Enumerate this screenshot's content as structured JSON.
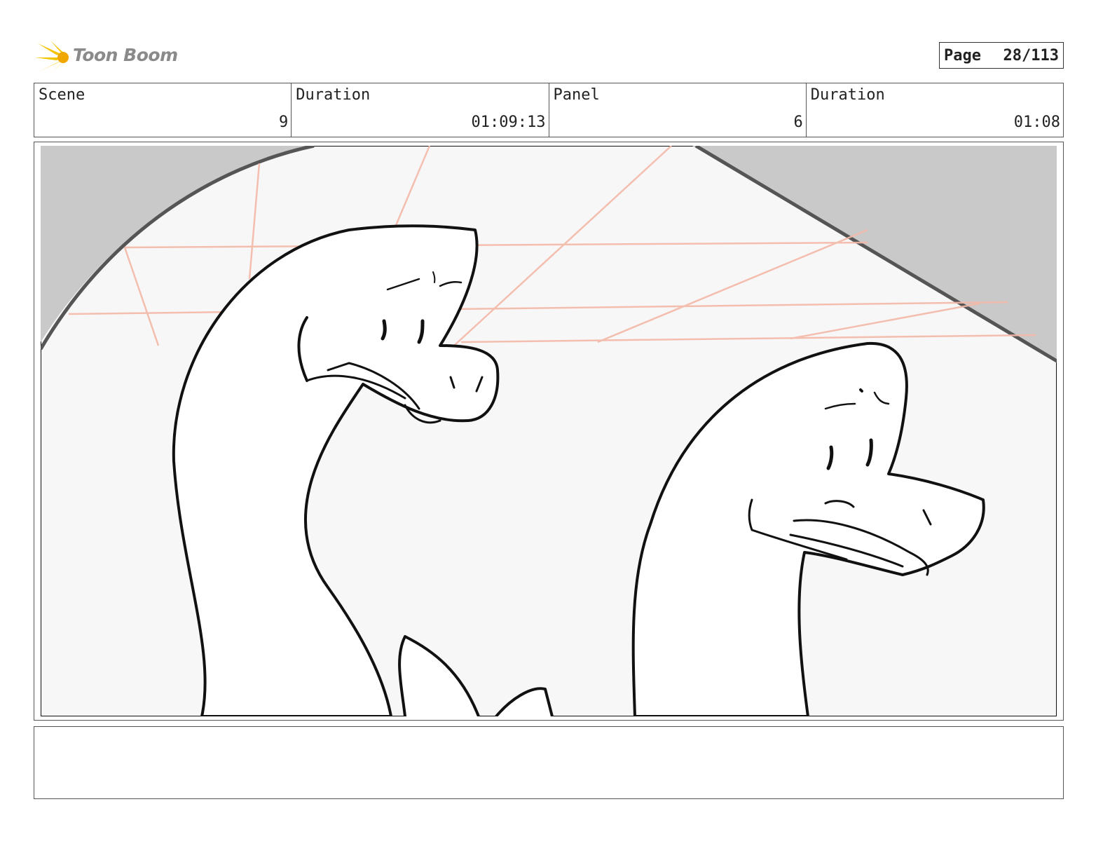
{
  "header": {
    "logo_text": "Toon Boom",
    "page_label": "Page",
    "page_number": "28/113"
  },
  "info": {
    "scene_label": "Scene",
    "scene_value": "9",
    "scene_duration_label": "Duration",
    "scene_duration_value": "01:09:13",
    "panel_label": "Panel",
    "panel_value": "6",
    "panel_duration_label": "Duration",
    "panel_duration_value": "01:08"
  },
  "notes": {
    "text": ""
  },
  "colors": {
    "logo_yellow": "#f5c400",
    "guide_lines": "#f4b8a8",
    "shadow_gray": "#c9c9c9",
    "panel_bg": "#f7f7f7"
  }
}
